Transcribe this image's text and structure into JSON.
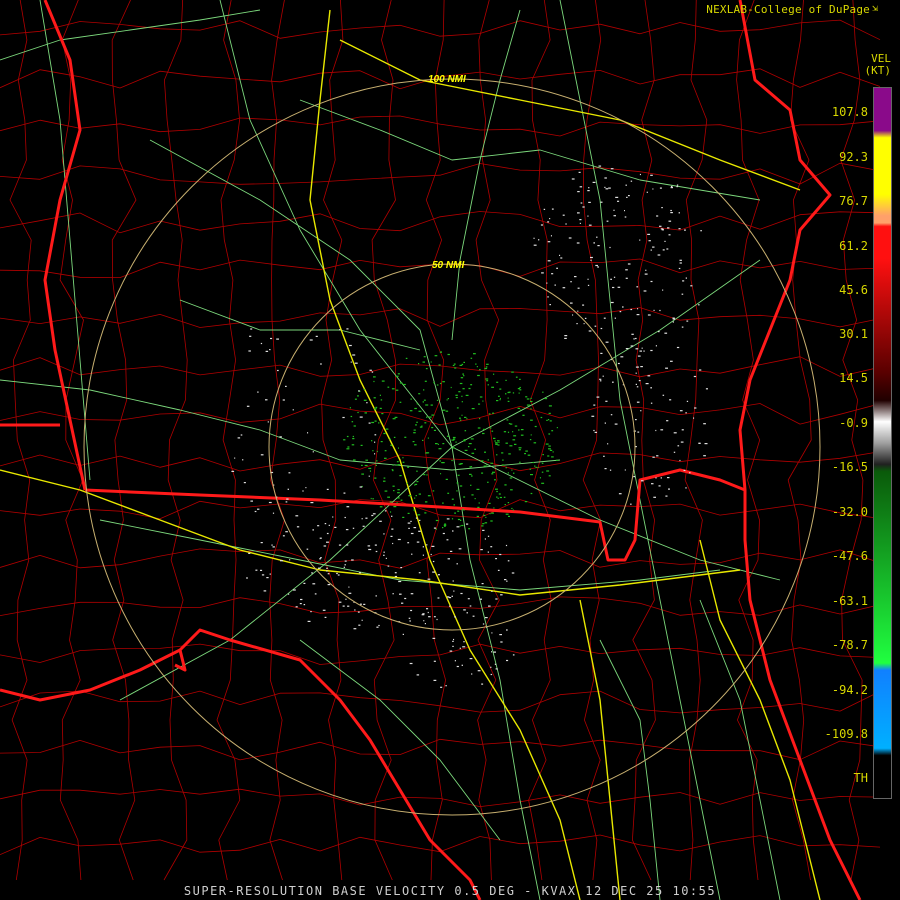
{
  "credit": "NEXLAB-College of DuPage",
  "product_code": "VEL",
  "unit": "(KT)",
  "scale": {
    "labels": [
      "107.8",
      "92.3",
      "76.7",
      "61.2",
      "45.6",
      "30.1",
      "14.5",
      "-0.9",
      "-16.5",
      "-32.0",
      "-47.6",
      "-63.1",
      "-78.7",
      "-94.2",
      "-109.8",
      "TH"
    ],
    "colors": {
      "purple": "#8a0a8a",
      "yellow": "#ffff00",
      "peach": "#ffa06a",
      "red": "#ff1010",
      "darkred": "#5a0000",
      "grey": "#a0a0a0",
      "darkgreen": "#0a5a0a",
      "green": "#20ff40",
      "blue": "#1080ff",
      "lightblue": "#00b0ff"
    }
  },
  "range_rings": [
    {
      "label": "50 NMI"
    },
    {
      "label": "100 NMI"
    }
  ],
  "map_colors": {
    "state_borders": "#ff1a1a",
    "county_borders": "#b00000",
    "highways": "#7cd87c",
    "interstates": "#e8e800",
    "range_ring": "#c8b070",
    "echo_white": "#e0e0e0",
    "echo_green": "#20c020"
  },
  "title": "SUPER-RESOLUTION BASE VELOCITY 0.5 DEG - KVAX 12 DEC 25 10:55"
}
